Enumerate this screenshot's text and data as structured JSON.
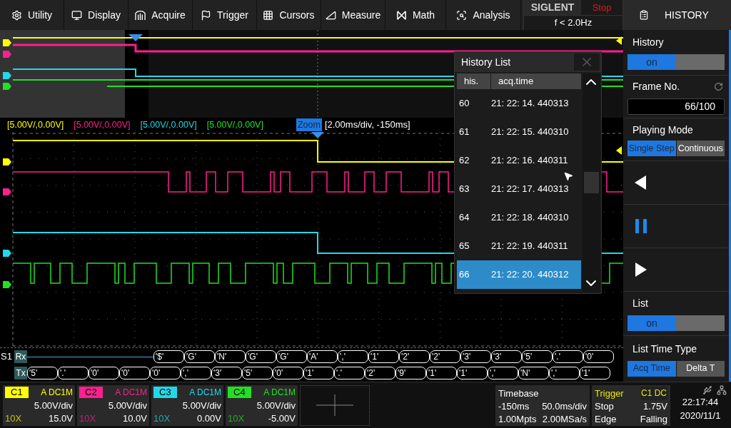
{
  "menu": [
    {
      "label": "Utility"
    },
    {
      "label": "Display"
    },
    {
      "label": "Acquire"
    },
    {
      "label": "Trigger"
    },
    {
      "label": "Cursors"
    },
    {
      "label": "Measure"
    },
    {
      "label": "Math"
    },
    {
      "label": "Analysis"
    }
  ],
  "brand": {
    "logo": "SIGLENT",
    "run_state": "Stop",
    "trigger_freq": "f < 2.0Hz"
  },
  "panel": {
    "title": "HISTORY",
    "history": {
      "label": "History",
      "value": "on",
      "on": true
    },
    "frame": {
      "label": "Frame No.",
      "value": "66/100"
    },
    "playing_mode": {
      "label": "Playing Mode",
      "options": [
        {
          "label": "Single Step",
          "selected": true
        },
        {
          "label": "Continuous",
          "selected": false
        }
      ]
    },
    "list": {
      "label": "List",
      "value": "on",
      "on": true
    },
    "list_time_type": {
      "label": "List Time Type",
      "options": [
        {
          "label": "Acq Time",
          "selected": true
        },
        {
          "label": "Delta T",
          "selected": false
        }
      ]
    }
  },
  "scale_labels": [
    {
      "text": "[5.00V/,0.00V]"
    },
    {
      "text": "[5.00V/,0.00V]"
    },
    {
      "text": "[5.00V/,0.00V]"
    },
    {
      "text": "[5.00V/,0.00V]"
    }
  ],
  "zoom": {
    "label": "Zoom",
    "info": "[2.00ms/div, -150ms]"
  },
  "decode": {
    "bus": "S1",
    "rows": [
      {
        "label": "Rx",
        "packets": [
          "'$'",
          "'G'",
          "'N'",
          "'G'",
          "'G'",
          "'A'",
          "','",
          "'1'",
          "'2'",
          "'2'",
          "'3'",
          "'3'",
          "'5'",
          "'.'",
          "'0'"
        ]
      },
      {
        "label": "Tx",
        "packets": [
          "'5'",
          "'.'",
          "'0'",
          "'0'",
          "'0'",
          "','",
          "'3'",
          "'5'",
          "'0'",
          "'1'",
          "'.'",
          "'2'",
          "'9'",
          "'1'",
          "'1'",
          "','",
          "'N'",
          "','",
          "'1'"
        ]
      }
    ]
  },
  "history_list": {
    "title": "History List",
    "columns": [
      "his.",
      "acq.time"
    ],
    "rows": [
      {
        "his": "60",
        "time": "21: 22: 14. 440313",
        "selected": false
      },
      {
        "his": "61",
        "time": "21: 22: 15. 440310",
        "selected": false
      },
      {
        "his": "62",
        "time": "21: 22: 16. 440311",
        "selected": false
      },
      {
        "his": "63",
        "time": "21: 22: 17. 440313",
        "selected": false
      },
      {
        "his": "64",
        "time": "21: 22: 18. 440310",
        "selected": false
      },
      {
        "his": "65",
        "time": "21: 22: 19. 440311",
        "selected": false
      },
      {
        "his": "66",
        "time": "21: 22: 20. 440312",
        "selected": true
      }
    ]
  },
  "channels": [
    {
      "name": "C1",
      "color": "#ffff00",
      "coupling": "A DC1M",
      "scale": "5.00V/div",
      "probe": "10X",
      "offset": "15.0V"
    },
    {
      "name": "C2",
      "color": "#ff1f8f",
      "coupling": "A DC1M",
      "scale": "5.00V/div",
      "probe": "10X",
      "offset": "10.0V"
    },
    {
      "name": "C3",
      "color": "#22d8e8",
      "coupling": "A DC1M",
      "scale": "5.00V/div",
      "probe": "10X",
      "offset": "0.00V"
    },
    {
      "name": "C4",
      "color": "#22e022",
      "coupling": "A DC1M",
      "scale": "5.00V/div",
      "probe": "10X",
      "offset": "-5.00V"
    }
  ],
  "timebase": {
    "title": "Timebase",
    "delay": "-150ms",
    "scale": "50.0ms/div",
    "depth": "1.00Mpts",
    "rate": "2.00MSa/s"
  },
  "trigger": {
    "title": "Trigger",
    "source": "C1 DC",
    "state": "Stop",
    "level": "1.75V",
    "type": "Edge",
    "slope": "Falling"
  },
  "status": {
    "time": "22:17:44",
    "date": "2020/11/1"
  }
}
